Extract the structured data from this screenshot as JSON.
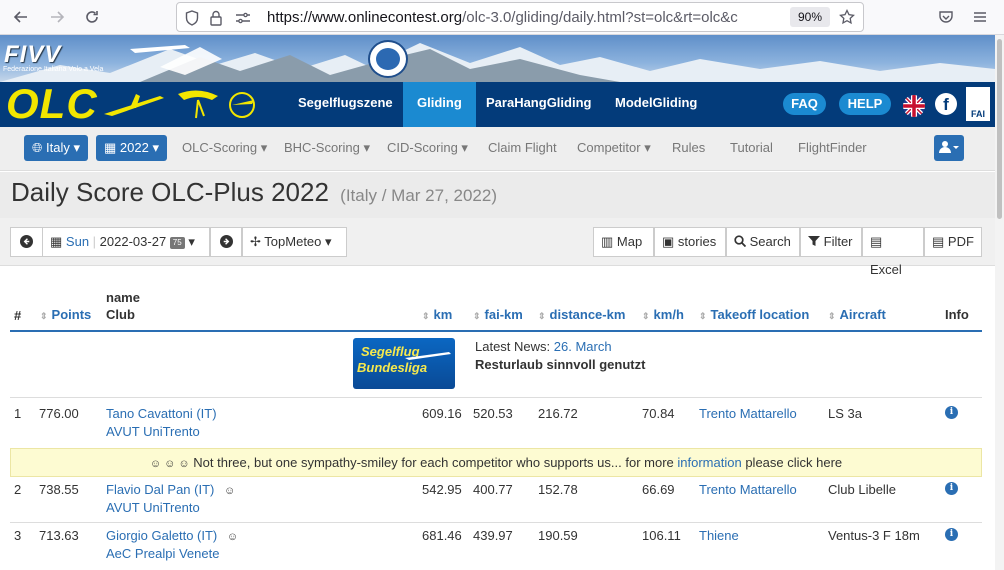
{
  "browser": {
    "url_domain": "https://www.onlinecontest.org",
    "url_path": "/olc-3.0/gliding/daily.html?st=olc&rt=olc&c",
    "zoom": "90%"
  },
  "banner": {
    "org": "FIVV",
    "org_full": "Federazione Italiana Volo a Vela"
  },
  "mainnav": {
    "logo": "OLC",
    "items": [
      "Segelflugszene",
      "Gliding",
      "ParaHangGliding",
      "ModelGliding"
    ],
    "faq": "FAQ",
    "help": "HELP",
    "fai": "FAI",
    "facebook": "f"
  },
  "subnav": {
    "country": "Italy",
    "year": "2022",
    "items": [
      "OLC-Scoring",
      "BHC-Scoring",
      "CID-Scoring",
      "Claim Flight",
      "Competitor",
      "Rules",
      "Tutorial",
      "FlightFinder"
    ]
  },
  "title": {
    "main": "Daily Score OLC-Plus 2022",
    "sub": "(Italy / Mar 27, 2022)"
  },
  "toolbar": {
    "day": "Sun",
    "date": "2022-03-27",
    "count": "75",
    "topmeteo": "TopMeteo",
    "map": "Map",
    "stories": "stories",
    "search": "Search",
    "filter": "Filter",
    "excel": "Excel",
    "pdf": "PDF"
  },
  "table": {
    "headers": {
      "rank": "#",
      "points": "Points",
      "name": "name",
      "club": "Club",
      "km": "km",
      "fai_km": "fai-km",
      "distance_km": "distance-km",
      "kmh": "km/h",
      "takeoff": "Takeoff location",
      "aircraft": "Aircraft",
      "info": "Info"
    },
    "news": {
      "img_line1": "Segelflug",
      "img_line2": "Bundesliga",
      "prefix": "Latest News:",
      "date": "26. March",
      "headline": "Resturlaub sinnvoll genutzt"
    },
    "rows": [
      {
        "rank": "1",
        "points": "776.00",
        "name": "Tano Cavattoni (IT)",
        "club": "AVUT UniTrento",
        "km": "609.16",
        "fai_km": "520.53",
        "distance_km": "216.72",
        "kmh": "70.84",
        "takeoff": "Trento Mattarello",
        "aircraft": "LS 3a",
        "smiley": ""
      },
      {
        "rank": "2",
        "points": "738.55",
        "name": "Flavio Dal Pan (IT)",
        "club": "AVUT UniTrento",
        "km": "542.95",
        "fai_km": "400.77",
        "distance_km": "152.78",
        "kmh": "66.69",
        "takeoff": "Trento Mattarello",
        "aircraft": "Club Libelle",
        "smiley": "☺"
      },
      {
        "rank": "3",
        "points": "713.63",
        "name": "Giorgio Galetto (IT)",
        "club": "AeC Prealpi Venete",
        "km": "681.46",
        "fai_km": "439.97",
        "distance_km": "190.59",
        "kmh": "106.11",
        "takeoff": "Thiene",
        "aircraft": "Ventus-3 F 18m",
        "smiley": "☺"
      }
    ],
    "sympathy": {
      "smileys": "☺ ☺ ☺",
      "text": "Not three, but one sympathy-smiley for each competitor who supports us... for more",
      "link": "information",
      "tail": "please click here"
    }
  }
}
